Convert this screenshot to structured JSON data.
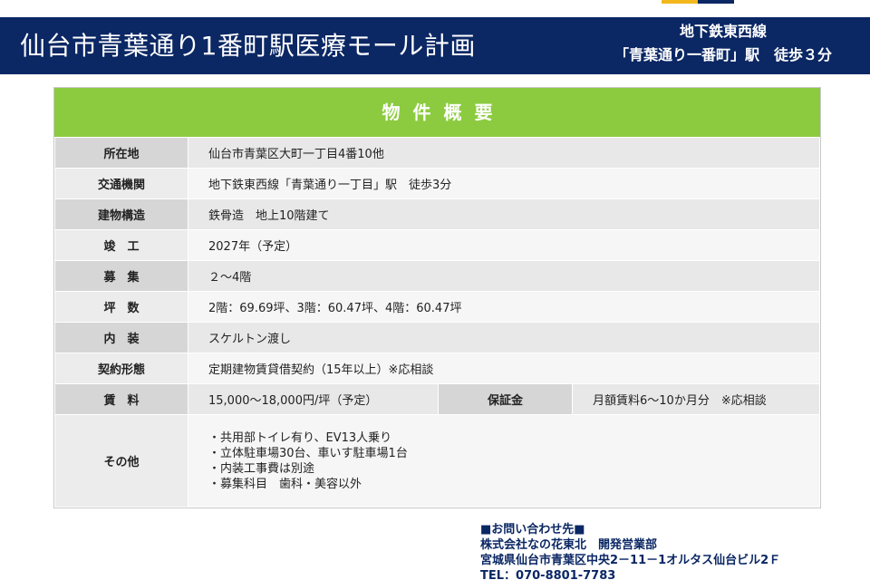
{
  "colors": {
    "header_bg": "#0b2764",
    "overview_title_bg": "#8ccb3f",
    "accent_yellow": "#f1b71c",
    "accent_navy": "#0b2764"
  },
  "header": {
    "title": "仙台市青葉通り1番町駅医療モール計画",
    "access_line1": "地下鉄東西線",
    "access_line2": "「青葉通り一番町」駅　徒歩３分"
  },
  "overview": {
    "title": "物件概要",
    "rows": [
      {
        "label": "所在地",
        "value": "仙台市青葉区大町一丁目4番10他"
      },
      {
        "label": "交通機関",
        "value": "地下鉄東西線「青葉通り一丁目」駅　徒歩3分"
      },
      {
        "label": "建物構造",
        "value": "鉄骨造　地上10階建て"
      },
      {
        "label": "竣　工",
        "value": "2027年（予定）"
      },
      {
        "label": "募　集",
        "value": "２～4階"
      },
      {
        "label": "坪　数",
        "value": "2階：69.69坪、3階：60.47坪、4階：60.47坪"
      },
      {
        "label": "内　装",
        "value": "スケルトン渡し"
      },
      {
        "label": "契約形態",
        "value": "定期建物賃貸借契約（15年以上）※応相談"
      }
    ],
    "rent": {
      "label": "賃　料",
      "value": "15,000～18,000円/坪（予定）",
      "deposit_label": "保証金",
      "deposit_value": "月額賃料6～10か月分　※応相談"
    },
    "others": {
      "label": "その他",
      "items": [
        "・共用部トイレ有り、EV13人乗り",
        "・立体駐車場30台、車いす駐車場1台",
        "・内装工事費は別途",
        "・募集科目　歯科・美容以外"
      ]
    }
  },
  "contact": {
    "heading": "■お問い合わせ先■",
    "company": "株式会社なの花東北　開発営業部",
    "address": "宮城県仙台市青葉区中央2－11－1オルタス仙台ビル2Ｆ",
    "tel": "TEL：070-8801-7783"
  }
}
